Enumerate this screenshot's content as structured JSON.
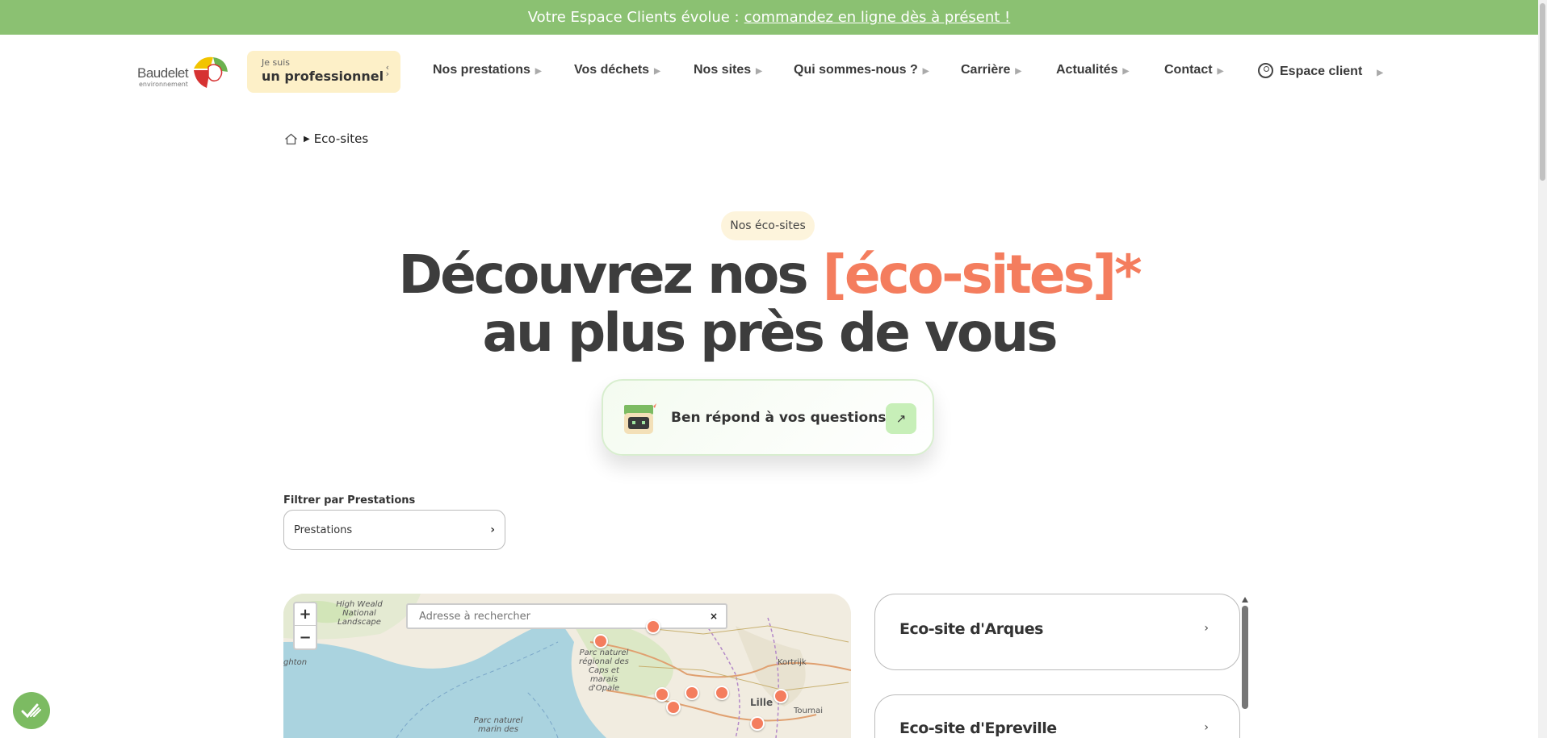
{
  "topbar": {
    "text": "Votre Espace Clients évolue :",
    "link": "commandez en ligne dès à présent !"
  },
  "header": {
    "logo_text": "Baudelet",
    "logo_subtext": "environnement",
    "profile_select": {
      "small": "Je suis",
      "value": "un professionnel"
    },
    "nav": [
      {
        "label": "Nos prestations"
      },
      {
        "label": "Vos déchets"
      },
      {
        "label": "Nos sites"
      },
      {
        "label": "Qui sommes-nous ?"
      },
      {
        "label": "Carrière"
      },
      {
        "label": "Actualités"
      },
      {
        "label": "Contact"
      },
      {
        "label": "Espace client"
      }
    ]
  },
  "breadcrumb": {
    "current": "Eco-sites"
  },
  "hero": {
    "badge": "Nos éco-sites",
    "line1_a": "Découvrez nos",
    "line1_accent": "[éco-sites]*",
    "line2": "au plus près de vous"
  },
  "ben": {
    "label": "Ben répond à vos questions",
    "arrow": "↗"
  },
  "filter": {
    "label": "Filtrer par Prestations",
    "value": "Prestations"
  },
  "map": {
    "search_placeholder": "Adresse à rechercher",
    "zoom_in": "+",
    "zoom_out": "−",
    "clear": "×",
    "labels": {
      "highweald": "High Weald National Landscape",
      "brighton": "ghton",
      "parc_caps": "Parc naturel régional des Caps et marais d'Opale",
      "parc_marin": "Parc naturel marin des",
      "kortrijk": "Kortrijk",
      "lille": "Lille",
      "tournai": "Tournai"
    }
  },
  "sites": [
    {
      "name": "Eco-site d'Arques"
    },
    {
      "name": "Eco-site d'Epreville"
    }
  ],
  "colors": {
    "topbar": "#8bc172",
    "accent": "#f47d5e",
    "select_bg": "#fdf0c8",
    "ben_button": "#c7efb8"
  },
  "icons": {
    "breadcrumb_home": "home-icon",
    "user": "user-circle-icon",
    "cookie": "cookie-consent-icon",
    "chevron": "chevron-right-icon"
  }
}
